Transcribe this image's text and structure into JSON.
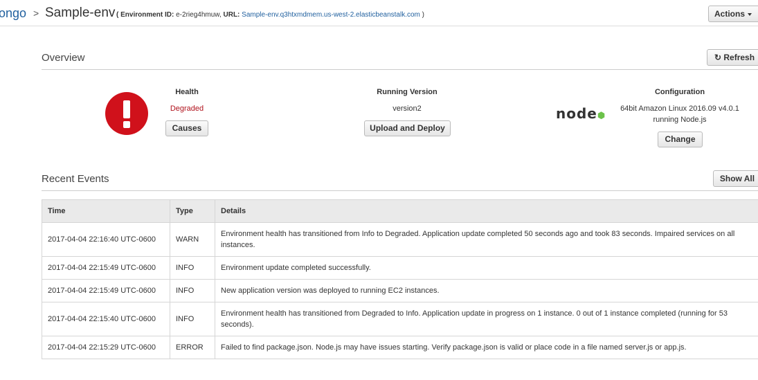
{
  "header": {
    "app_name": "ongo",
    "separator": ">",
    "env_name": "Sample-env",
    "env_id_label": "( Environment ID:",
    "env_id": "e-2rieg4hmuw,",
    "url_label": "URL:",
    "url": "Sample-env.q3htxmdmem.us-west-2.elasticbeanstalk.com",
    "close_paren": ")",
    "actions_label": "Actions"
  },
  "overview": {
    "title": "Overview",
    "refresh_label": "Refresh",
    "health": {
      "label": "Health",
      "value": "Degraded",
      "button": "Causes",
      "color": "#d0111b"
    },
    "running_version": {
      "label": "Running Version",
      "value": "version2",
      "button": "Upload and Deploy"
    },
    "configuration": {
      "label": "Configuration",
      "line1": "64bit Amazon Linux 2016.09 v4.0.1",
      "line2": "running Node.js",
      "button": "Change",
      "logo_text": "node"
    }
  },
  "events": {
    "title": "Recent Events",
    "show_all_label": "Show All",
    "columns": [
      "Time",
      "Type",
      "Details"
    ],
    "rows": [
      {
        "time": "2017-04-04 22:16:40 UTC-0600",
        "type": "WARN",
        "details": "Environment health has transitioned from Info to Degraded. Application update completed 50 seconds ago and took 83 seconds. Impaired services on all instances."
      },
      {
        "time": "2017-04-04 22:15:49 UTC-0600",
        "type": "INFO",
        "details": "Environment update completed successfully."
      },
      {
        "time": "2017-04-04 22:15:49 UTC-0600",
        "type": "INFO",
        "details": "New application version was deployed to running EC2 instances."
      },
      {
        "time": "2017-04-04 22:15:40 UTC-0600",
        "type": "INFO",
        "details": "Environment health has transitioned from Degraded to Info. Application update in progress on 1 instance. 0 out of 1 instance completed (running for 53 seconds)."
      },
      {
        "time": "2017-04-04 22:15:29 UTC-0600",
        "type": "ERROR",
        "details": "Failed to find package.json. Node.js may have issues starting. Verify package.json is valid or place code in a file named server.js or app.js."
      }
    ]
  }
}
